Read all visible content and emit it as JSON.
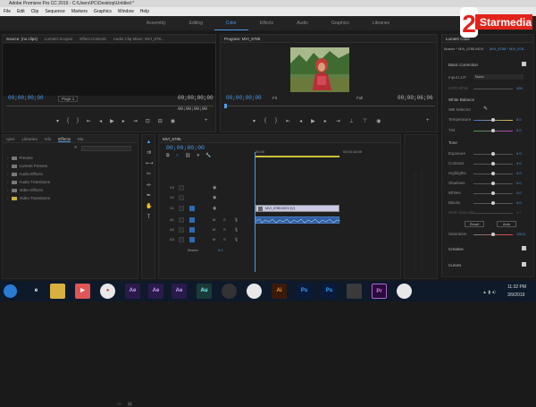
{
  "window": {
    "title": "Adobe Premiere Pro CC 2019 - C:\\Users\\PC\\Desktop\\Untitled *"
  },
  "menu": [
    "File",
    "Edit",
    "Clip",
    "Sequence",
    "Markers",
    "Graphics",
    "Window",
    "Help"
  ],
  "workspaces": {
    "items": [
      "Assembly",
      "Editing",
      "Color",
      "Effects",
      "Audio",
      "Graphics",
      "Libraries"
    ],
    "active": "Color"
  },
  "source_panel": {
    "tabs": [
      "Source: (no clips)",
      "Lumetri Scopes",
      "Effect Controls",
      "Audio Clip Mixer: MVI_678..."
    ],
    "timecode_left": "00;00;00;00",
    "page": "Page 1",
    "timecode_right": "00;00;00;00",
    "timecode_right2": "00;00;00;00"
  },
  "program_panel": {
    "title": "Program: MVI_6785",
    "timecode_left": "00;00;00;00",
    "fit": "Fit",
    "full": "Full",
    "timecode_right": "00;00;06;06"
  },
  "lumetri": {
    "title": "Lumetri Color",
    "master": "Master * MVI_6785.MOV",
    "clip": "MVI_6785 * MVI_678...",
    "basic_correction": "Basic Correction",
    "input_lut_label": "Input LUT",
    "input_lut_value": "None",
    "hdr_white_label": "HDR White",
    "hdr_white_value": "100",
    "white_balance": "White Balance",
    "wb_selector": "WB Selector",
    "temperature": {
      "label": "Temperature",
      "value": "0.0"
    },
    "tint": {
      "label": "Tint",
      "value": "0.0"
    },
    "tone": "Tone",
    "exposure": {
      "label": "Exposure",
      "value": "0.0"
    },
    "contrast": {
      "label": "Contrast",
      "value": "0.0"
    },
    "highlights": {
      "label": "Highlights",
      "value": "0.0"
    },
    "shadows": {
      "label": "Shadows",
      "value": "0.0"
    },
    "whites": {
      "label": "Whites",
      "value": "0.0"
    },
    "blacks": {
      "label": "Blacks",
      "value": "0.0"
    },
    "hdr_specular": {
      "label": "HDR Specular",
      "value": "0.0"
    },
    "reset": "Reset",
    "auto": "Auto",
    "saturation": {
      "label": "Saturation",
      "value": "100.0"
    },
    "creative": "Creative",
    "curves": "Curves"
  },
  "effects_panel": {
    "tabs": [
      "oject",
      "Libraries",
      "Info",
      "Effects",
      "Ma"
    ],
    "active_tab": "Effects",
    "items": [
      "Presets",
      "Lumetri Presets",
      "Audio Effects",
      "Audio Transitions",
      "Video Effects",
      "Video Transitions"
    ]
  },
  "timeline": {
    "tab": "MVI_6785",
    "timecode": "00;00;00;00",
    "ruler": [
      "00;00",
      "00;00;16;00"
    ],
    "video_tracks": [
      "V3",
      "V2",
      "V1"
    ],
    "audio_tracks": [
      "A1",
      "A2",
      "A3"
    ],
    "master": "Master",
    "master_value": "0.0",
    "clip_label": "MVI_6785.MOV [V]"
  },
  "taskbar": {
    "time": "11:32 PM",
    "date": "3/9/2019",
    "apps": [
      "Ae",
      "Ae",
      "Ae",
      "Au",
      "",
      "",
      "Ai",
      "Ps",
      "Ps",
      "",
      "Pr",
      ""
    ]
  },
  "logo": {
    "text": "Starmedia",
    "digit": "2"
  },
  "colors": {
    "accent": "#4b9bea",
    "panel": "#1f1f1f",
    "taskbar": "#0e1a2a"
  }
}
